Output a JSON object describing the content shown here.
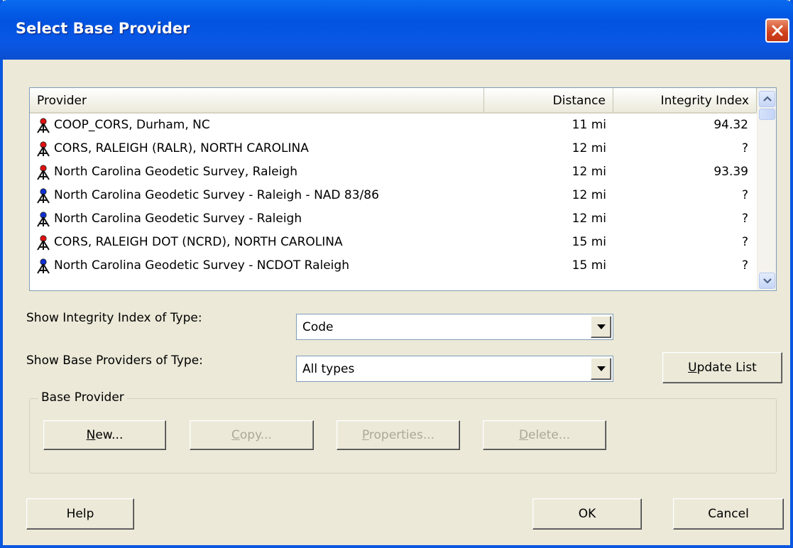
{
  "window": {
    "title": "Select Base Provider"
  },
  "list": {
    "columns": [
      "Provider",
      "Distance",
      "Integrity Index"
    ],
    "rows": [
      {
        "name": "COOP_CORS, Durham, NC",
        "distance": "11 mi",
        "integrity": "94.32",
        "icon": "survey-tripod-red",
        "icon_color": "#e01010"
      },
      {
        "name": "CORS, RALEIGH (RALR),  NORTH CAROLINA",
        "distance": "12 mi",
        "integrity": "?",
        "icon": "survey-tripod-red",
        "icon_color": "#e01010"
      },
      {
        "name": "North Carolina Geodetic Survey, Raleigh",
        "distance": "12 mi",
        "integrity": "93.39",
        "icon": "survey-tripod-red",
        "icon_color": "#e01010"
      },
      {
        "name": "North Carolina Geodetic Survey - Raleigh - NAD 83/86",
        "distance": "12 mi",
        "integrity": "?",
        "icon": "survey-tripod-blue",
        "icon_color": "#1030d0"
      },
      {
        "name": "North Carolina Geodetic Survey - Raleigh",
        "distance": "12 mi",
        "integrity": "?",
        "icon": "survey-tripod-blue",
        "icon_color": "#1030d0"
      },
      {
        "name": "CORS, RALEIGH DOT (NCRD),  NORTH CAROLINA",
        "distance": "15 mi",
        "integrity": "?",
        "icon": "survey-tripod-red",
        "icon_color": "#e01010"
      },
      {
        "name": "North Carolina Geodetic Survey - NCDOT Raleigh",
        "distance": "15 mi",
        "integrity": "?",
        "icon": "survey-tripod-blue",
        "icon_color": "#1030d0"
      }
    ]
  },
  "integrity_type": {
    "label": "Show Integrity Index of Type:",
    "value": "Code"
  },
  "provider_type": {
    "label": "Show Base Providers of Type:",
    "value": "All types"
  },
  "buttons": {
    "update_list": {
      "pre": "",
      "key": "U",
      "post": "pdate List"
    },
    "new": {
      "pre": "",
      "key": "N",
      "post": "ew..."
    },
    "copy": {
      "pre": "",
      "key": "C",
      "post": "opy..."
    },
    "properties": {
      "pre": "",
      "key": "P",
      "post": "roperties..."
    },
    "delete": {
      "pre": "",
      "key": "D",
      "post": "elete..."
    },
    "help": "Help",
    "ok": "OK",
    "cancel": "Cancel"
  },
  "group": {
    "title": "Base Provider"
  },
  "colors": {
    "titlebar": "#0153e0",
    "dialog_bg": "#ece9d8",
    "close": "#d0421b"
  }
}
